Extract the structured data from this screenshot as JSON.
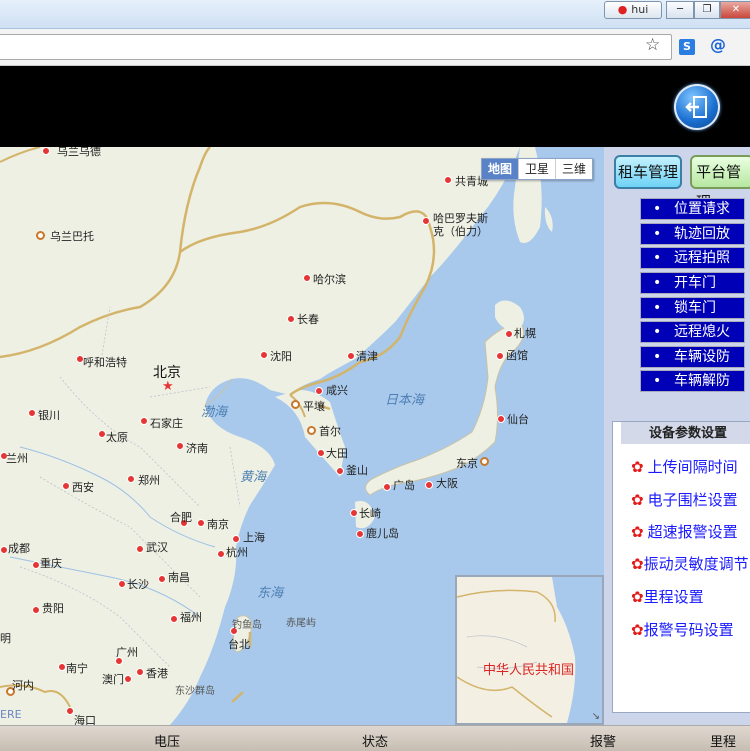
{
  "titlebar": {
    "user_label": "hui"
  },
  "header": {
    "exit_icon": "exit-icon"
  },
  "map": {
    "type_buttons": [
      "地图",
      "卫星",
      "三维"
    ],
    "selected_type": "地图",
    "cities": {
      "wulanbatuo": "乌兰巴托",
      "beijing": "北京",
      "hohhot": "呼和浩特",
      "yinchuan": "银川",
      "lanzhou": "兰州",
      "xian": "西安",
      "taiyuan": "太原",
      "shijiazhuang": "石家庄",
      "jinan": "济南",
      "zhengzhou": "郑州",
      "hefei": "合肥",
      "nanjing": "南京",
      "shanghai": "上海",
      "hangzhou": "杭州",
      "wuhan": "武汉",
      "chengdu": "成都",
      "chongqing": "重庆",
      "changsha": "长沙",
      "nanchang": "南昌",
      "guiyang": "贵阳",
      "fuzhou": "福州",
      "taibei": "台北",
      "guangzhou": "广州",
      "xianggang": "香港",
      "aomen": "澳门",
      "nanning": "南宁",
      "haikou": "海口",
      "hanoi": "河内",
      "kunming": "明",
      "shenyang": "沈阳",
      "changchun": "长春",
      "harbin": "哈尔滨",
      "qingjin": "清津",
      "xianxing": "咸兴",
      "pingrang": "平壤",
      "shouer": "首尔",
      "daitian": "大田",
      "fushan": "釜山",
      "guangdao": "广岛",
      "daban": "大阪",
      "dongjing": "东京",
      "changqi": "长崎",
      "luerdao": "鹿儿岛",
      "xiantai": "仙台",
      "hanguan": "函馆",
      "zhahuang": "札幌",
      "habaluofu": "哈巴罗夫斯",
      "habaluofu2": "克（伯力）",
      "gongqingcheng": "共青城",
      "wulansiwude": "乌兰乌德"
    },
    "seas": {
      "bohai": "渤海",
      "huanghai": "黄海",
      "donghai": "东海",
      "ribenhai": "日本海"
    },
    "islands": {
      "diaoyudao": "钓鱼岛",
      "chiweiyu": "赤尾屿",
      "dongsha": "东沙群岛"
    },
    "watermark": "ERE",
    "inset_label": "中华人民共和国"
  },
  "sidebar": {
    "tabs": [
      "租车管理",
      "平台管理"
    ],
    "commands": [
      "位置请求",
      "轨迹回放",
      "远程拍照",
      "开车门",
      "锁车门",
      "远程熄火",
      "车辆设防",
      "车辆解防"
    ],
    "params_title": "设备参数设置",
    "params": [
      "上传间隔时间",
      "电子围栏设置",
      "超速报警设置",
      "振动灵敏度调节",
      "里程设置",
      "报警号码设置"
    ]
  },
  "statusbar": {
    "cells": [
      "电压",
      "状态",
      "报警",
      "里程"
    ]
  },
  "colors": {
    "header_bg": "#000000",
    "command_bg": "#0000b6",
    "param_text": "#1a1aff",
    "gear": "#e21b1b",
    "sea": "#a8c9ec",
    "land": "#eef0e3"
  }
}
